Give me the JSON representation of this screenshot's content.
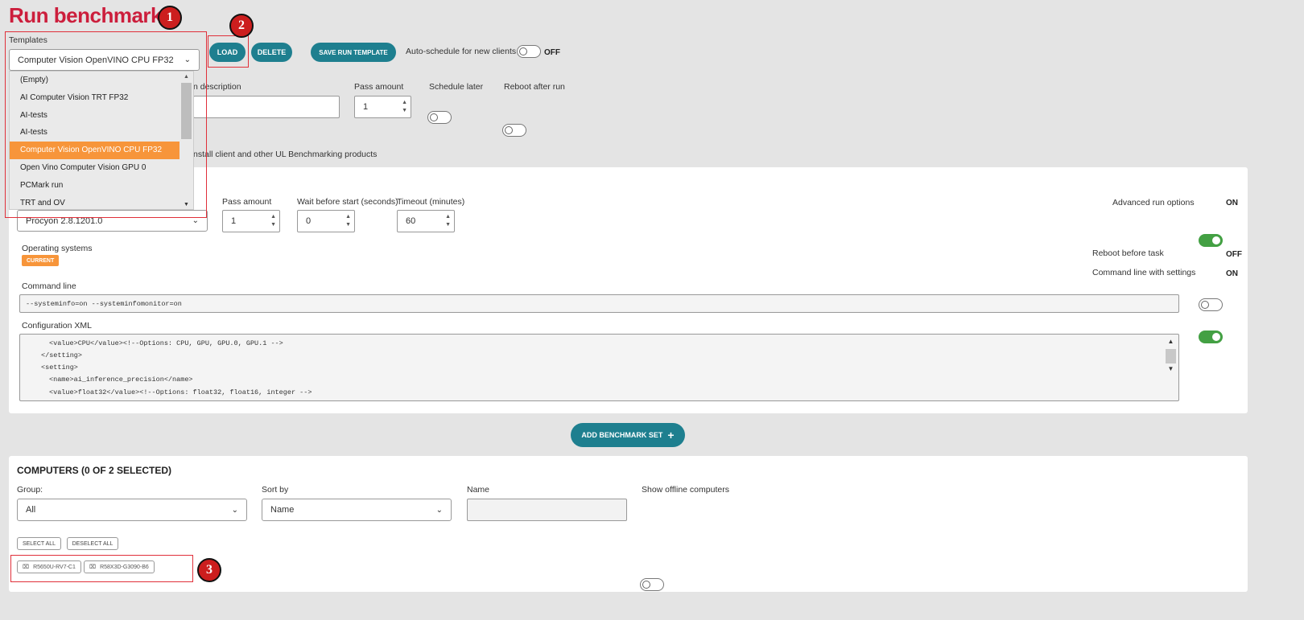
{
  "page": {
    "title": "Run benchmarks"
  },
  "templates": {
    "label": "Templates",
    "selected": "Computer Vision OpenVINO CPU FP32",
    "options": [
      "(Empty)",
      "AI Computer Vision TRT FP32",
      "AI-tests",
      "AI-tests",
      "Computer Vision OpenVINO CPU FP32",
      "Open Vino Computer Vision GPU 0",
      "PCMark run",
      "TRT and OV"
    ],
    "load_label": "LOAD",
    "delete_label": "DELETE",
    "save_label": "SAVE RUN TEMPLATE",
    "auto_schedule_label": "Auto-schedule for new clients",
    "auto_schedule_state": "OFF"
  },
  "run": {
    "description_label": "n description",
    "pass_amount_label": "Pass amount",
    "pass_amount_value": "1",
    "schedule_later_label": "Schedule later",
    "reboot_after_label": "Reboot after run",
    "install_text": "nstall client and other UL Benchmarking products"
  },
  "benchmark_set": {
    "version_value": "Procyon 2.8.1201.0",
    "pass_amount_label": "Pass amount",
    "pass_amount_value": "1",
    "wait_label": "Wait before start (seconds)",
    "wait_value": "0",
    "timeout_label": "Timeout (minutes)",
    "timeout_value": "60",
    "advanced_label": "Advanced run options",
    "advanced_state": "ON",
    "os_label": "Operating systems",
    "os_badge": "CURRENT",
    "reboot_before_label": "Reboot before task",
    "reboot_before_state": "OFF",
    "cmd_settings_label": "Command line with settings",
    "cmd_settings_state": "ON",
    "cmdline_label": "Command line",
    "cmdline_value": "--systeminfo=on --systeminfomonitor=on",
    "xml_label": "Configuration XML",
    "xml_lines": [
      "<value>CPU</value><!--Options: CPU, GPU, GPU.0, GPU.1 -->",
      "</setting>",
      "<setting>",
      "<name>ai_inference_precision</name>",
      "<value>float32</value><!--Options: float32, float16, integer -->"
    ]
  },
  "add_set_label": "ADD BENCHMARK SET",
  "computers": {
    "title": "COMPUTERS (0 OF 2 SELECTED)",
    "group_label": "Group:",
    "group_value": "All",
    "sort_label": "Sort by",
    "sort_value": "Name",
    "name_label": "Name",
    "show_offline_label": "Show offline computers",
    "select_all": "SELECT ALL",
    "deselect_all": "DESELECT ALL",
    "chips": [
      "R5650U-RV7-C1",
      "R58X3D-G3090-B6"
    ]
  },
  "annotations": [
    "1",
    "2",
    "3"
  ]
}
